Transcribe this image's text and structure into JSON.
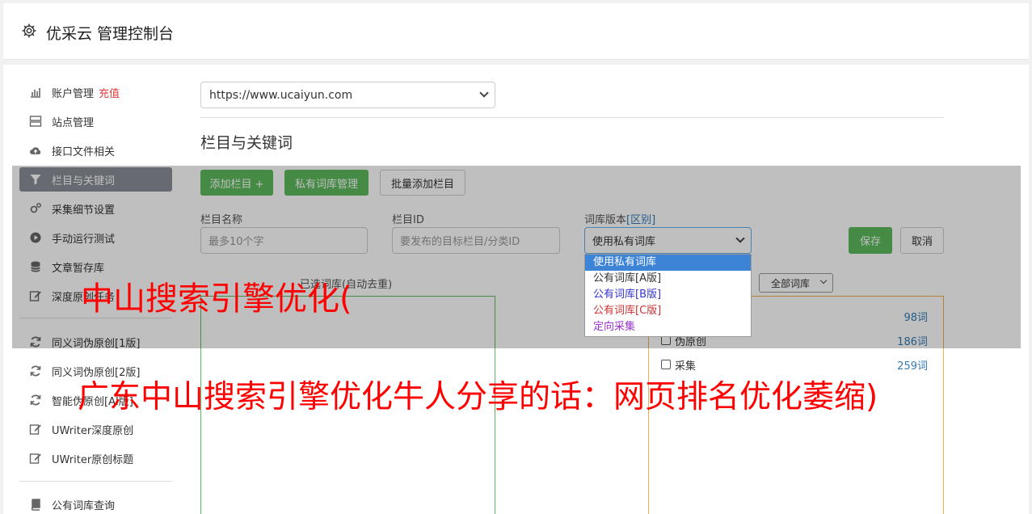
{
  "header": {
    "title": "优采云 管理控制台"
  },
  "sidebar": {
    "items": [
      {
        "label": "账户管理",
        "extra": "充值"
      },
      {
        "label": "站点管理"
      },
      {
        "label": "接口文件相关"
      },
      {
        "label": "栏目与关键词"
      },
      {
        "label": "采集细节设置"
      },
      {
        "label": "手动运行测试"
      },
      {
        "label": "文章暂存库"
      },
      {
        "label": "深度原创任务"
      },
      {
        "label": "同义词伪原创[1版]"
      },
      {
        "label": "同义词伪原创[2版]"
      },
      {
        "label": "智能伪原创[AI版]"
      },
      {
        "label": "UWriter深度原创"
      },
      {
        "label": "UWriter原创标题"
      },
      {
        "label": "公有词库查询"
      }
    ]
  },
  "site_select": {
    "value": "https://www.ucaiyun.com"
  },
  "section": {
    "title": "栏目与关键词"
  },
  "toolbar": {
    "add_column": "添加栏目 +",
    "private_lib": "私有词库管理",
    "bulk_add": "批量添加栏目"
  },
  "form": {
    "name_label": "栏目名称",
    "name_placeholder": "最多10个字",
    "id_label": "栏目ID",
    "id_placeholder": "要发布的目标栏目/分类ID",
    "version_label": "词库版本",
    "version_diff": "[区别]",
    "version_value": "使用私有词库",
    "save": "保存",
    "cancel": "取消"
  },
  "version_options": [
    {
      "label": "使用私有词库",
      "color": "#ffffff"
    },
    {
      "label": "公有词库[A版]",
      "color": "#333333"
    },
    {
      "label": "公有词库[B版]",
      "color": "#3333cc"
    },
    {
      "label": "公有词库[C版]",
      "color": "#cc3333"
    },
    {
      "label": "定向采集",
      "color": "#9933cc"
    }
  ],
  "selected_box": {
    "label": "已选词库(自动去重)"
  },
  "filter": {
    "value": "全部词库"
  },
  "libraries": [
    {
      "name": "",
      "count": "98词"
    },
    {
      "name": "伪原创",
      "count": "186词"
    },
    {
      "name": "采集",
      "count": "259词"
    }
  ],
  "watermark": {
    "line1": "中山搜索引擎优化(",
    "line2": "广东中山搜索引擎优化牛人分享的话：网页排名优化萎缩)"
  },
  "colors": {
    "primary_green": "#5cb85c",
    "link_blue": "#337ab7",
    "accent_red": "#e4393c"
  }
}
